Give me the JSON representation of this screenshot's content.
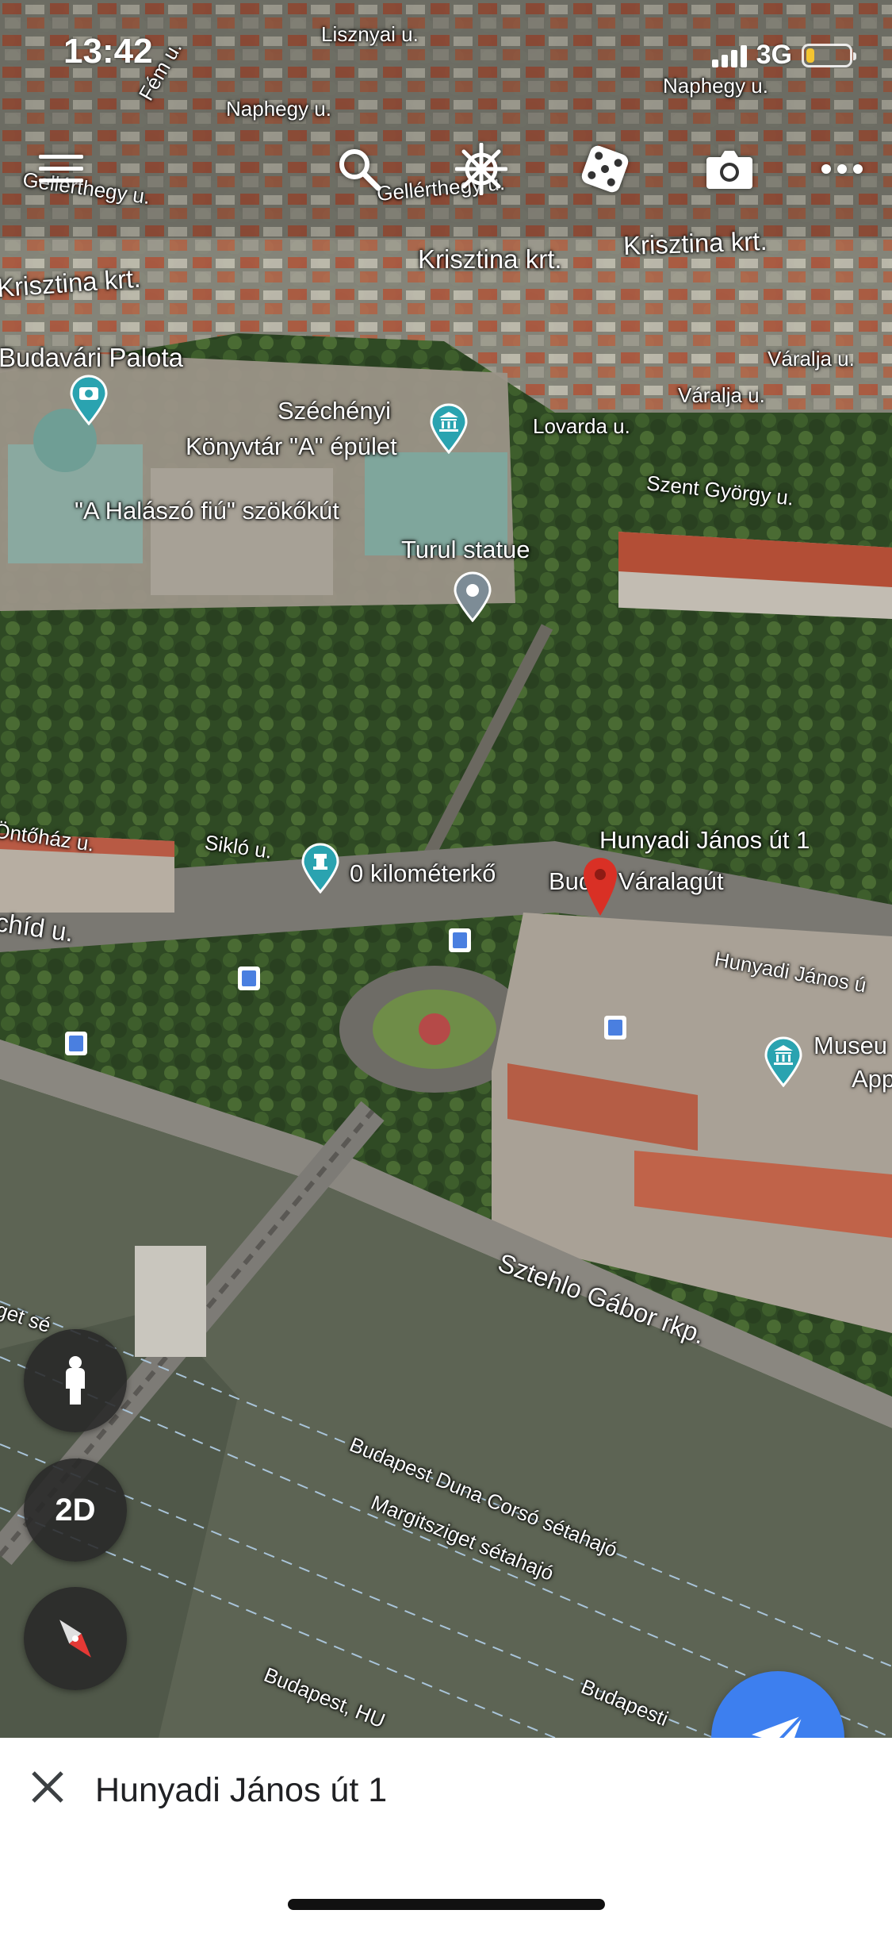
{
  "status_bar": {
    "time": "13:42",
    "network": "3G",
    "battery_level": 0.2,
    "battery_color": "#f4c430"
  },
  "toolbar": {
    "icons": [
      "menu-icon",
      "search-icon",
      "ship-wheel-icon",
      "dice-icon",
      "camera-icon",
      "more-icon"
    ]
  },
  "map": {
    "streets": {
      "lisznyai": "Lisznyai u.",
      "naphegy_1": "Naphegy u.",
      "naphegy_2": "Naphegy u.",
      "fem": "Fém u.",
      "gellerthegy_1": "Gellérthegy u.",
      "gellerthegy_2": "Gellérthegy u.",
      "krisztina_1": "Krisztina krt.",
      "krisztina_2": "Krisztina krt.",
      "krisztina_3": "Krisztina krt.",
      "varalja_1": "Váralja u.",
      "varalja_2": "Váralja u.",
      "lovarda": "Lovarda u.",
      "szent_gyorgy": "Szent György u.",
      "ontohaz": "Öntőház u.",
      "siklo": "Sikló u.",
      "hid": "chíd u.",
      "hunyadi_street": "Hunyadi János ú",
      "sztehlo": "Sztehlo Gábor rkp.",
      "get_se": "get sé"
    },
    "pois": {
      "budavari_palota": "Budavári Palota",
      "szechenyi_1": "Széchényi",
      "szechenyi_2": "Könyvtár \"A\" épület",
      "halasz_fiu": "\"A Halászó fiú\" szökőkút",
      "turul": "Turul statue",
      "zero_km": "0 kilométerkő",
      "hunyadi_pin": "Hunyadi János út 1",
      "varalagut": "Budai Váralagút",
      "museum_1": "Museu",
      "museum_2": "App"
    },
    "ferries": {
      "duna_corso": "Budapest Duna Corsó sétahajó",
      "margitsziget": "Margitsziget sétahajó",
      "budapest_hu": "Budapest, HU",
      "budapesti": "Budapesti"
    }
  },
  "controls": {
    "pegman_icon": "pegman-icon",
    "view_toggle": "2D",
    "compass_icon": "compass-icon",
    "send_icon": "send-icon"
  },
  "bottom_sheet": {
    "title": "Hunyadi János út 1",
    "close_icon": "close-icon"
  },
  "colors": {
    "accent": "#3d7fef",
    "pin": "#d93025",
    "poi_teal": "#2aa3b0"
  }
}
